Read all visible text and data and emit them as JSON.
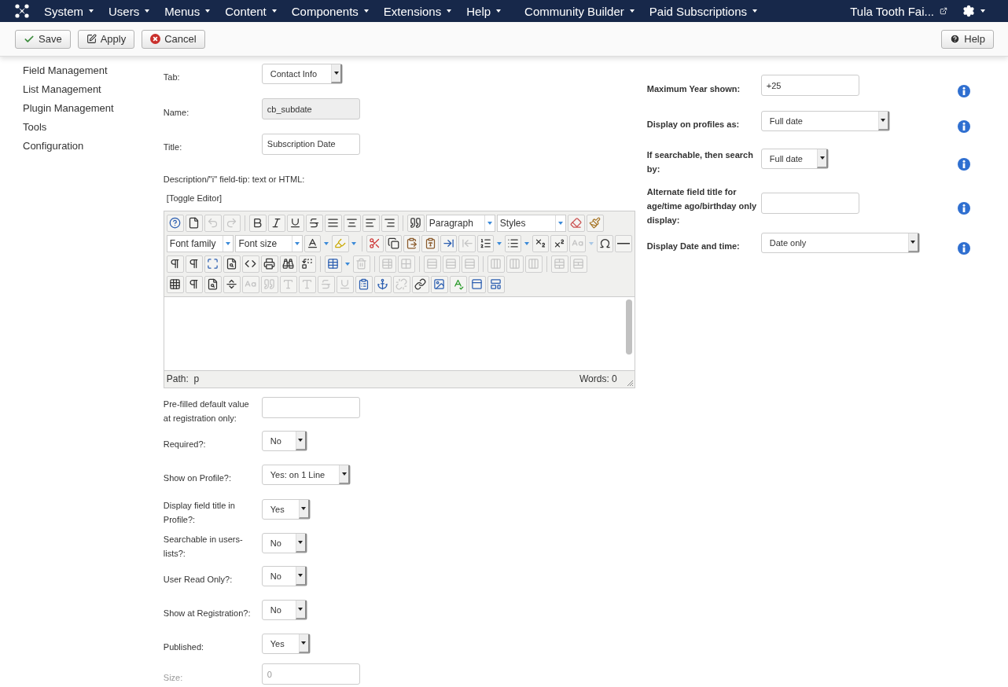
{
  "nav": {
    "menus": [
      {
        "label": "System"
      },
      {
        "label": "Users"
      },
      {
        "label": "Menus"
      },
      {
        "label": "Content"
      },
      {
        "label": "Components"
      },
      {
        "label": "Extensions"
      },
      {
        "label": "Help"
      },
      {
        "label": "Community Builder"
      },
      {
        "label": "Paid Subscriptions"
      }
    ],
    "site": "Tula Tooth Fai..."
  },
  "toolbar": {
    "buttons": [
      {
        "kind": "save",
        "label": "Save"
      },
      {
        "kind": "apply",
        "label": "Apply"
      },
      {
        "kind": "cancel",
        "label": "Cancel"
      }
    ],
    "help": "Help"
  },
  "sidebar": {
    "items": [
      "Field Management",
      "List Management",
      "Plugin Management",
      "Tools",
      "Configuration"
    ]
  },
  "form": {
    "fields_top": [
      {
        "label": "Tab:",
        "kind": "select",
        "value": "Contact Info"
      },
      {
        "label": "Name:",
        "kind": "text",
        "value": "cb_subdate",
        "readonly": true
      },
      {
        "label": "Title:",
        "kind": "text",
        "value": "Subscription Date",
        "readonly": false
      }
    ],
    "description_label": "Description/\"i\" field-tip: text or HTML:",
    "toggle_editor": "[Toggle Editor]",
    "editor": {
      "toolbar_rows": [
        [
          {
            "kind": "button",
            "disabled": false
          },
          {
            "kind": "button",
            "disabled": false
          },
          {
            "kind": "button",
            "disabled": true
          },
          {
            "kind": "button",
            "disabled": true
          },
          {
            "kind": "sep"
          },
          {
            "kind": "button",
            "disabled": false
          },
          {
            "kind": "button",
            "disabled": false
          },
          {
            "kind": "button",
            "disabled": false
          },
          {
            "kind": "button",
            "disabled": false
          },
          {
            "kind": "button",
            "disabled": false
          },
          {
            "kind": "button",
            "disabled": false
          },
          {
            "kind": "button",
            "disabled": false
          },
          {
            "kind": "button",
            "disabled": false
          },
          {
            "kind": "sep"
          },
          {
            "kind": "button",
            "disabled": false
          },
          {
            "kind": "select",
            "label": "Paragraph"
          },
          {
            "kind": "select",
            "label": "Styles"
          },
          {
            "kind": "button",
            "disabled": false
          },
          {
            "kind": "button",
            "disabled": false
          }
        ],
        [
          {
            "kind": "select",
            "label": "Font family"
          },
          {
            "kind": "select",
            "label": "Font size"
          },
          {
            "kind": "split",
            "disabled": false
          },
          {
            "kind": "split",
            "disabled": false
          },
          {
            "kind": "sep"
          },
          {
            "kind": "button",
            "disabled": false
          },
          {
            "kind": "button",
            "disabled": false
          },
          {
            "kind": "button",
            "disabled": false
          },
          {
            "kind": "button",
            "disabled": false
          },
          {
            "kind": "button",
            "disabled": false
          },
          {
            "kind": "button",
            "disabled": true
          },
          {
            "kind": "split",
            "disabled": false
          },
          {
            "kind": "split",
            "disabled": false
          },
          {
            "kind": "button",
            "disabled": false
          },
          {
            "kind": "button",
            "disabled": false
          },
          {
            "kind": "split",
            "disabled": true
          },
          {
            "kind": "button",
            "disabled": false
          },
          {
            "kind": "button",
            "disabled": false
          }
        ],
        [
          {
            "kind": "button",
            "disabled": false
          },
          {
            "kind": "button",
            "disabled": false
          },
          {
            "kind": "button",
            "disabled": false
          },
          {
            "kind": "button",
            "disabled": false
          },
          {
            "kind": "button",
            "disabled": false
          },
          {
            "kind": "button",
            "disabled": false
          },
          {
            "kind": "button",
            "disabled": false
          },
          {
            "kind": "button",
            "disabled": false
          },
          {
            "kind": "sep"
          },
          {
            "kind": "split",
            "disabled": false
          },
          {
            "kind": "button",
            "disabled": true
          },
          {
            "kind": "sep"
          },
          {
            "kind": "button",
            "disabled": true
          },
          {
            "kind": "button",
            "disabled": true
          },
          {
            "kind": "sep"
          },
          {
            "kind": "button",
            "disabled": true
          },
          {
            "kind": "button",
            "disabled": true
          },
          {
            "kind": "button",
            "disabled": true
          },
          {
            "kind": "sep"
          },
          {
            "kind": "button",
            "disabled": true
          },
          {
            "kind": "button",
            "disabled": true
          },
          {
            "kind": "button",
            "disabled": true
          },
          {
            "kind": "sep"
          },
          {
            "kind": "button",
            "disabled": true
          },
          {
            "kind": "button",
            "disabled": true
          }
        ],
        [
          {
            "kind": "button",
            "disabled": false
          },
          {
            "kind": "button",
            "disabled": false
          },
          {
            "kind": "button",
            "disabled": false
          },
          {
            "kind": "button",
            "disabled": false
          },
          {
            "kind": "button",
            "disabled": true
          },
          {
            "kind": "button",
            "disabled": true
          },
          {
            "kind": "button",
            "disabled": true
          },
          {
            "kind": "button",
            "disabled": true
          },
          {
            "kind": "button",
            "disabled": true
          },
          {
            "kind": "button",
            "disabled": true
          },
          {
            "kind": "button",
            "disabled": false
          },
          {
            "kind": "button",
            "disabled": false
          },
          {
            "kind": "button",
            "disabled": true
          },
          {
            "kind": "button",
            "disabled": false
          },
          {
            "kind": "button",
            "disabled": false
          },
          {
            "kind": "button",
            "disabled": false
          },
          {
            "kind": "button",
            "disabled": false
          },
          {
            "kind": "button",
            "disabled": false
          }
        ]
      ],
      "path_label": "Path:",
      "path": "p",
      "words": "Words: 0"
    },
    "fields_bottom": [
      {
        "label": "Pre-filled default value at registration only:",
        "kind": "text",
        "readonly": false
      },
      {
        "label": "Required?:",
        "kind": "select",
        "value": "No"
      },
      {
        "label": "Show on Profile?:",
        "kind": "select",
        "value": "Yes: on 1 Line"
      },
      {
        "label": "Display field title in Profile?:",
        "kind": "select",
        "value": "Yes"
      },
      {
        "label": "Searchable in users-lists?:",
        "kind": "select",
        "value": "No"
      },
      {
        "label": "User Read Only?:",
        "kind": "select",
        "value": "No"
      },
      {
        "label": "Show at Registration?:",
        "kind": "select",
        "value": "No"
      },
      {
        "label": "Published:",
        "kind": "select",
        "value": "Yes"
      },
      {
        "label": "Size:",
        "kind": "text",
        "value": "0",
        "readonly": false,
        "disabled": true
      }
    ]
  },
  "options": {
    "fields": [
      {
        "label": "Maximum Year shown:",
        "kind": "text",
        "value": "+25"
      },
      {
        "label": "Display on profiles as:",
        "kind": "select",
        "value": "Full date",
        "wide": true
      },
      {
        "label": "If searchable, then search by:",
        "kind": "select",
        "value": "Full date",
        "wide": false
      },
      {
        "label": "Alternate field title for age/time ago/birthday only display:",
        "kind": "text"
      },
      {
        "label": "Display Date and time:",
        "kind": "select",
        "value": "Date only",
        "wide": true
      }
    ]
  }
}
